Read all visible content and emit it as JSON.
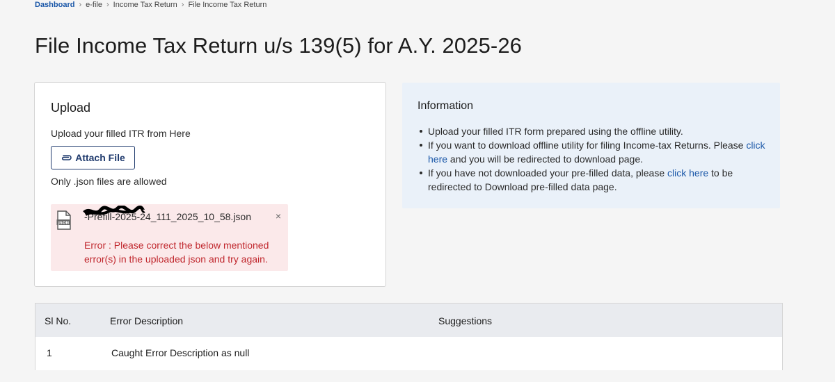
{
  "breadcrumb": {
    "items": [
      "Dashboard",
      "e-file",
      "Income Tax Return",
      "File Income Tax Return"
    ],
    "separator": "›"
  },
  "page_title": "File Income Tax Return u/s 139(5) for A.Y. 2025-26",
  "upload": {
    "title": "Upload",
    "hint": "Upload your filled ITR from Here",
    "attach_label": "Attach File",
    "allowed_note": "Only .json files are allowed",
    "file": {
      "name": "-Prefill-2025-24_111_2025_10_58.json",
      "icon": "json-file-icon",
      "error_prefix": "Error :",
      "error_message": "Please correct the below mentioned error(s) in the uploaded json and try again.",
      "close_symbol": "×"
    }
  },
  "information": {
    "title": "Information",
    "item1": "Upload your filled ITR form prepared using the offline utility.",
    "item2_before": "If you want to download offline utility for filing Income-tax Returns. Please",
    "item2_link": "click here",
    "item2_after": "and you will be redirected to download page.",
    "item3_before": "If you have not downloaded your pre-filled data, please",
    "item3_link": "click here",
    "item3_after": "to be redirected to Download pre-filled data page."
  },
  "error_table": {
    "headers": [
      "Sl No.",
      "Error Description",
      "Suggestions"
    ],
    "rows": [
      {
        "sl": "1",
        "description": "Caught Error Description as null",
        "suggestion": ""
      }
    ]
  },
  "colors": {
    "link": "#1a57a8",
    "error": "#c0272d",
    "error_bg": "#fbe9ea",
    "info_bg": "#eaf1f9",
    "button_border": "#1f3a6d"
  }
}
